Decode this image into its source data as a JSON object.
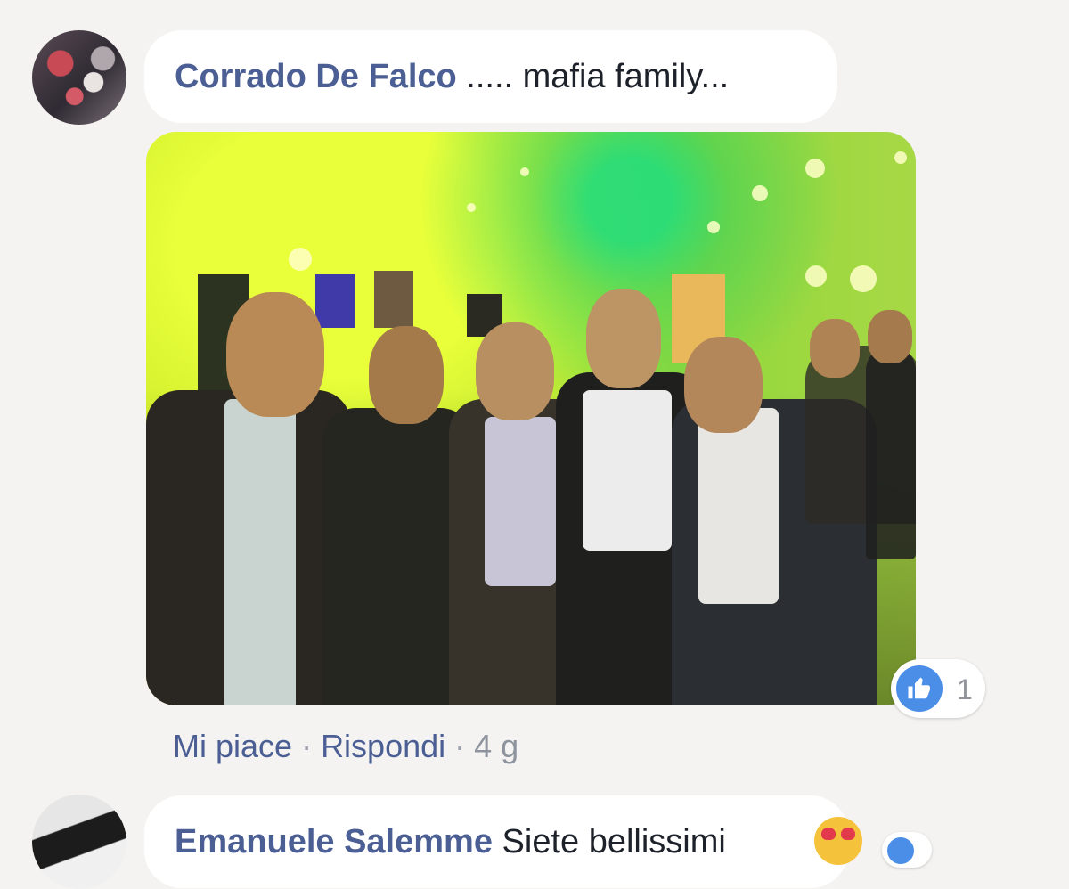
{
  "comments": [
    {
      "author": "Corrado De Falco",
      "text": " ..... mafia family...",
      "reaction_count": "1",
      "actions": {
        "like": "Mi piace",
        "reply": "Rispondi",
        "time": "4 g",
        "separator": " · "
      }
    },
    {
      "author": "Emanuele Salemme",
      "text": " Siete bellissimi"
    }
  ],
  "icons": {
    "like": "thumbs-up-icon",
    "emoji": "heart-eyes-emoji"
  },
  "colors": {
    "author": "#4c5f94",
    "like_blue": "#4b8ee8",
    "background": "#f4f3f1",
    "bubble": "#ffffff"
  }
}
